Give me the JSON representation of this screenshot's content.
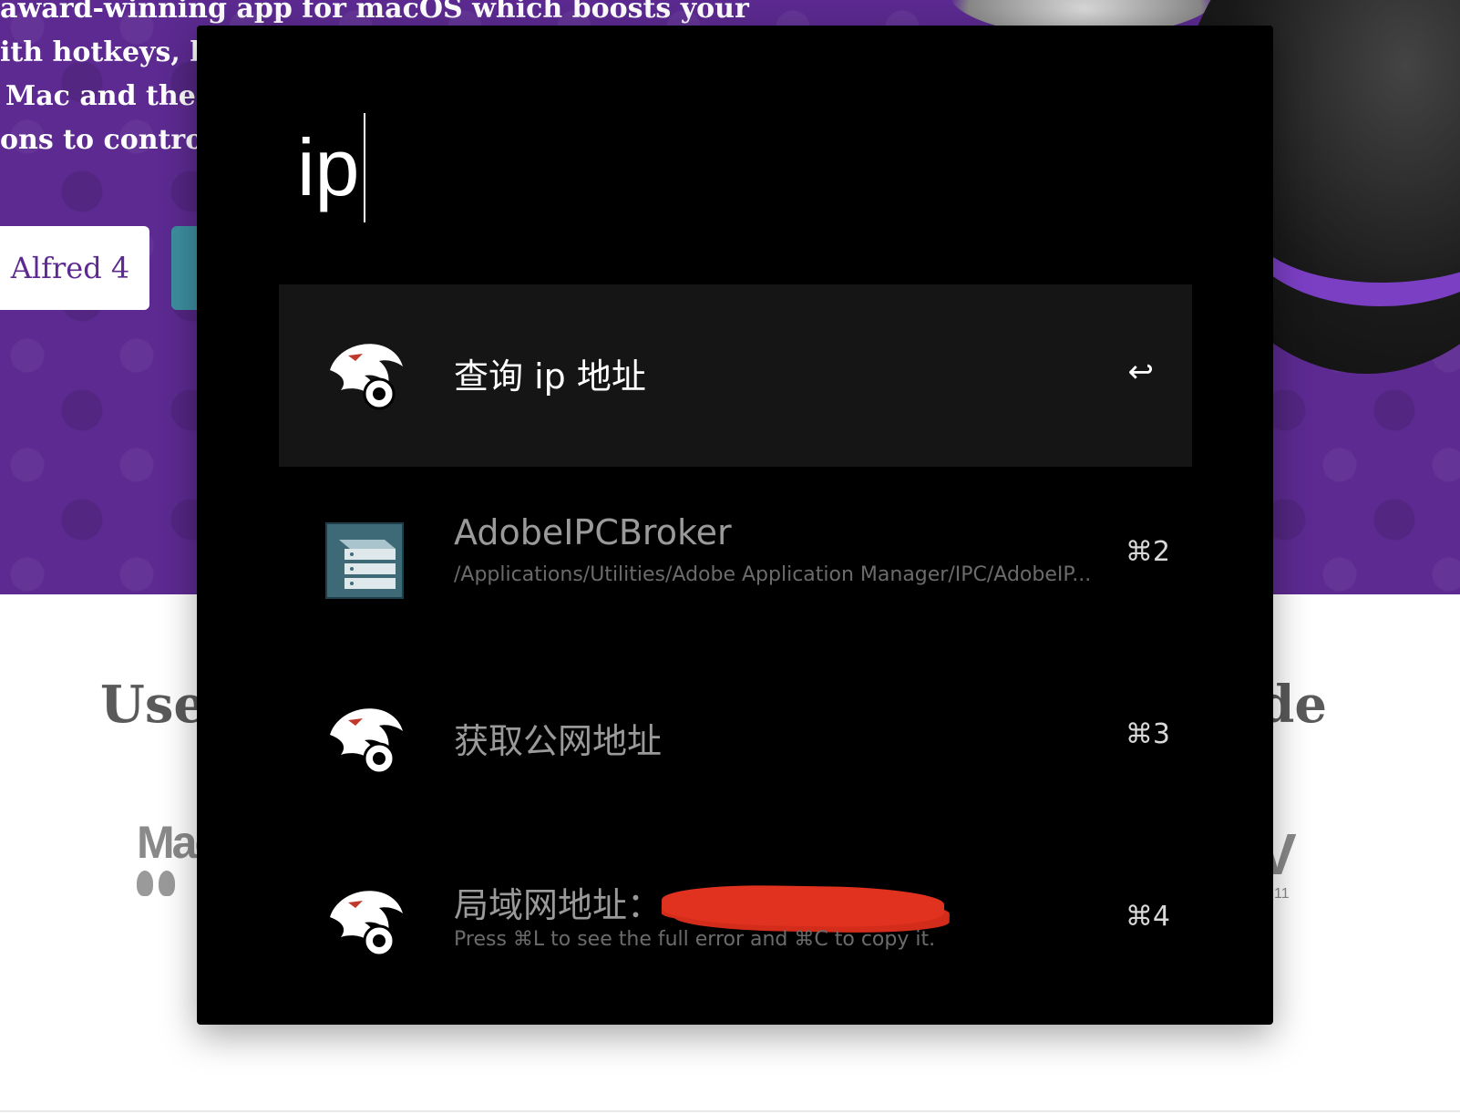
{
  "background": {
    "hero_lines": [
      "award-winning app for macOS which boosts your",
      "ith hotkeys, ke",
      "Mac and the w",
      "ons to control y"
    ],
    "primary_button_label": "Alfred 4",
    "lower_heading_left": "Use",
    "lower_heading_right": "ide",
    "press_logo_left": "Mac",
    "press_logo_right": "V",
    "press_logo_right_sub": "11",
    "hero_color": "#5c2a91"
  },
  "alfred": {
    "query": "ip",
    "results": [
      {
        "title": "查询 ip 地址",
        "subtitle": "",
        "shortcut": "↩",
        "icon": "alfred-workflow-icon",
        "selected": true
      },
      {
        "title": "AdobeIPCBroker",
        "subtitle": "/Applications/Utilities/Adobe Application Manager/IPC/AdobeIP...",
        "shortcut": "⌘2",
        "icon": "app-server-icon",
        "selected": false
      },
      {
        "title": "获取公网地址",
        "subtitle": "",
        "shortcut": "⌘3",
        "icon": "alfred-workflow-icon",
        "selected": false
      },
      {
        "title": "局域网地址：",
        "subtitle": "Press ⌘L to see the full error and ⌘C to copy it.",
        "shortcut": "⌘4",
        "icon": "alfred-workflow-icon",
        "selected": false
      }
    ]
  }
}
